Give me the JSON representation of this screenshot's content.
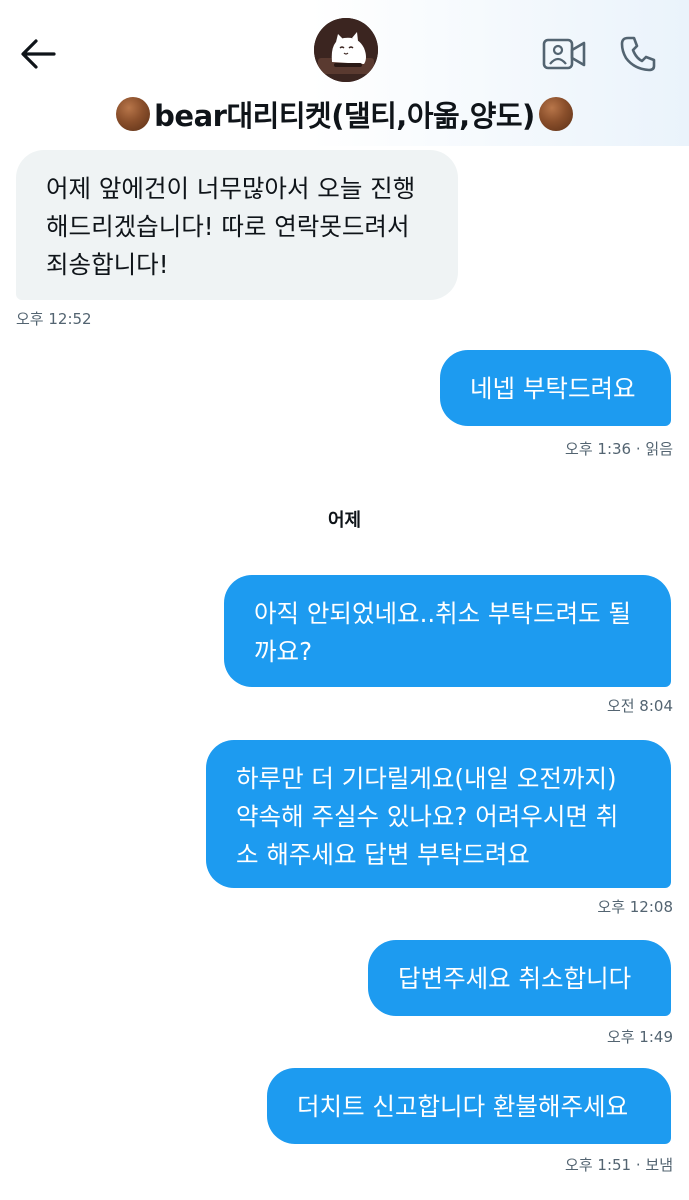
{
  "header": {
    "title": "bear대리티켓(댈티,아옮,양도)",
    "icons": {
      "back": "back-arrow-icon",
      "video": "video-camera-icon",
      "call": "phone-icon"
    }
  },
  "colors": {
    "outgoing_bubble": "#1d9bf0",
    "incoming_bubble": "#eff3f4",
    "text": "#0f1419",
    "meta": "#536471"
  },
  "messages": [
    {
      "direction": "incoming",
      "text": "어제 앞에건이 너무많아서 오늘 진행\n해드리겠습니다! 따로 연락못드려서\n죄송합니다!",
      "meta": "오후 12:52"
    },
    {
      "direction": "outgoing",
      "text": "네넵 부탁드려요",
      "meta": "오후 1:36 · 읽음"
    },
    {
      "direction": "outgoing",
      "text": "아직 안되었네요..취소 부탁드려도 될\n까요?",
      "meta": "오전 8:04"
    },
    {
      "direction": "outgoing",
      "text": "하루만 더 기다릴게요(내일 오전까지)\n약속해 주실수 있나요? 어려우시면 취\n소 해주세요 답변 부탁드려요",
      "meta": "오후 12:08"
    },
    {
      "direction": "outgoing",
      "text": "답변주세요 취소합니다",
      "meta": "오후 1:49"
    },
    {
      "direction": "outgoing",
      "text": "더치트 신고합니다 환불해주세요",
      "meta": "오후 1:51 · 보냄"
    }
  ],
  "day_separator": "어제"
}
